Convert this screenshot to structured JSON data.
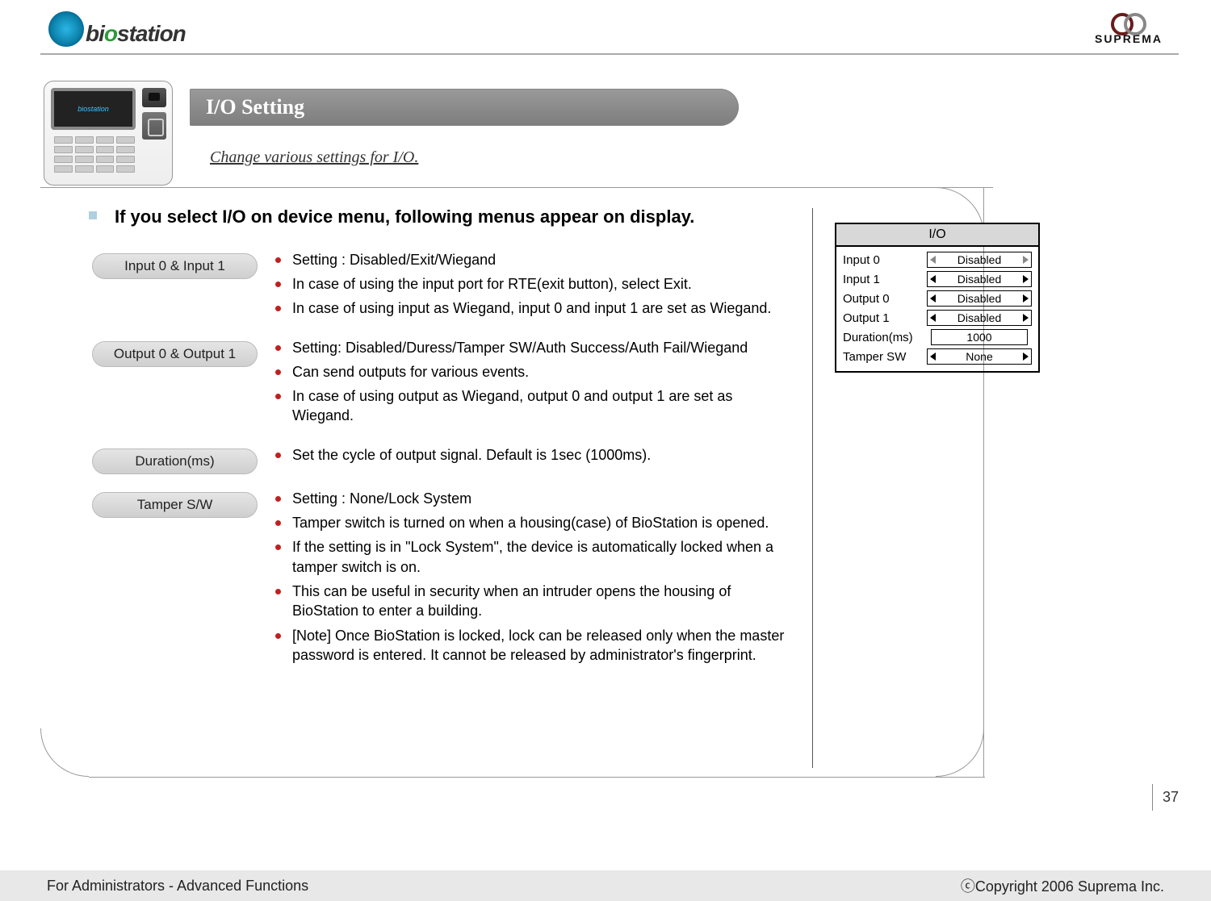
{
  "header": {
    "logo_left_text_prefix": "bi",
    "logo_left_text_green": "o",
    "logo_left_text_suffix": "station",
    "logo_right_text": "SUPREMA"
  },
  "device": {
    "screen_text": "biostation"
  },
  "title": {
    "heading": "I/O Setting",
    "subtitle": "Change various settings for I/O."
  },
  "main_heading": "If you select I/O on device menu, following menus appear on display.",
  "sections": [
    {
      "pill": "Input 0 & Input 1",
      "bullets": [
        "Setting : Disabled/Exit/Wiegand",
        "In case of using the input port for RTE(exit button), select Exit.",
        "In case of using input as Wiegand, input 0 and input 1 are set as Wiegand."
      ]
    },
    {
      "pill": "Output 0 & Output 1",
      "bullets": [
        "Setting: Disabled/Duress/Tamper SW/Auth Success/Auth Fail/Wiegand",
        "Can send outputs for various events.",
        "In case of using output as Wiegand, output 0 and output 1 are set as Wiegand."
      ]
    },
    {
      "pill": "Duration(ms)",
      "bullets": [
        "Set the cycle of output signal. Default is 1sec (1000ms)."
      ]
    },
    {
      "pill": "Tamper S/W",
      "bullets": [
        "Setting : None/Lock System",
        "Tamper switch is turned on when a housing(case) of BioStation is opened.",
        "If the setting is in \"Lock System\", the device is automatically locked when a tamper switch is on.",
        "This can be useful in security when an intruder opens the housing of BioStation to enter a building.",
        "[Note] Once BioStation is locked, lock can be released only when the master password is entered. It cannot be released by administrator's fingerprint."
      ]
    }
  ],
  "io_panel": {
    "title": "I/O",
    "rows": [
      {
        "label": "Input 0",
        "value": "Disabled",
        "type": "selector",
        "active": false
      },
      {
        "label": "Input 1",
        "value": "Disabled",
        "type": "selector",
        "active": true
      },
      {
        "label": "Output 0",
        "value": "Disabled",
        "type": "selector",
        "active": true
      },
      {
        "label": "Output 1",
        "value": "Disabled",
        "type": "selector",
        "active": true
      },
      {
        "label": "Duration(ms)",
        "value": "1000",
        "type": "number"
      },
      {
        "label": "Tamper SW",
        "value": "None",
        "type": "selector",
        "active": true
      }
    ]
  },
  "page_number": "37",
  "footer": {
    "left": "For Administrators - Advanced Functions",
    "right": "ⓒCopyright 2006 Suprema Inc."
  }
}
